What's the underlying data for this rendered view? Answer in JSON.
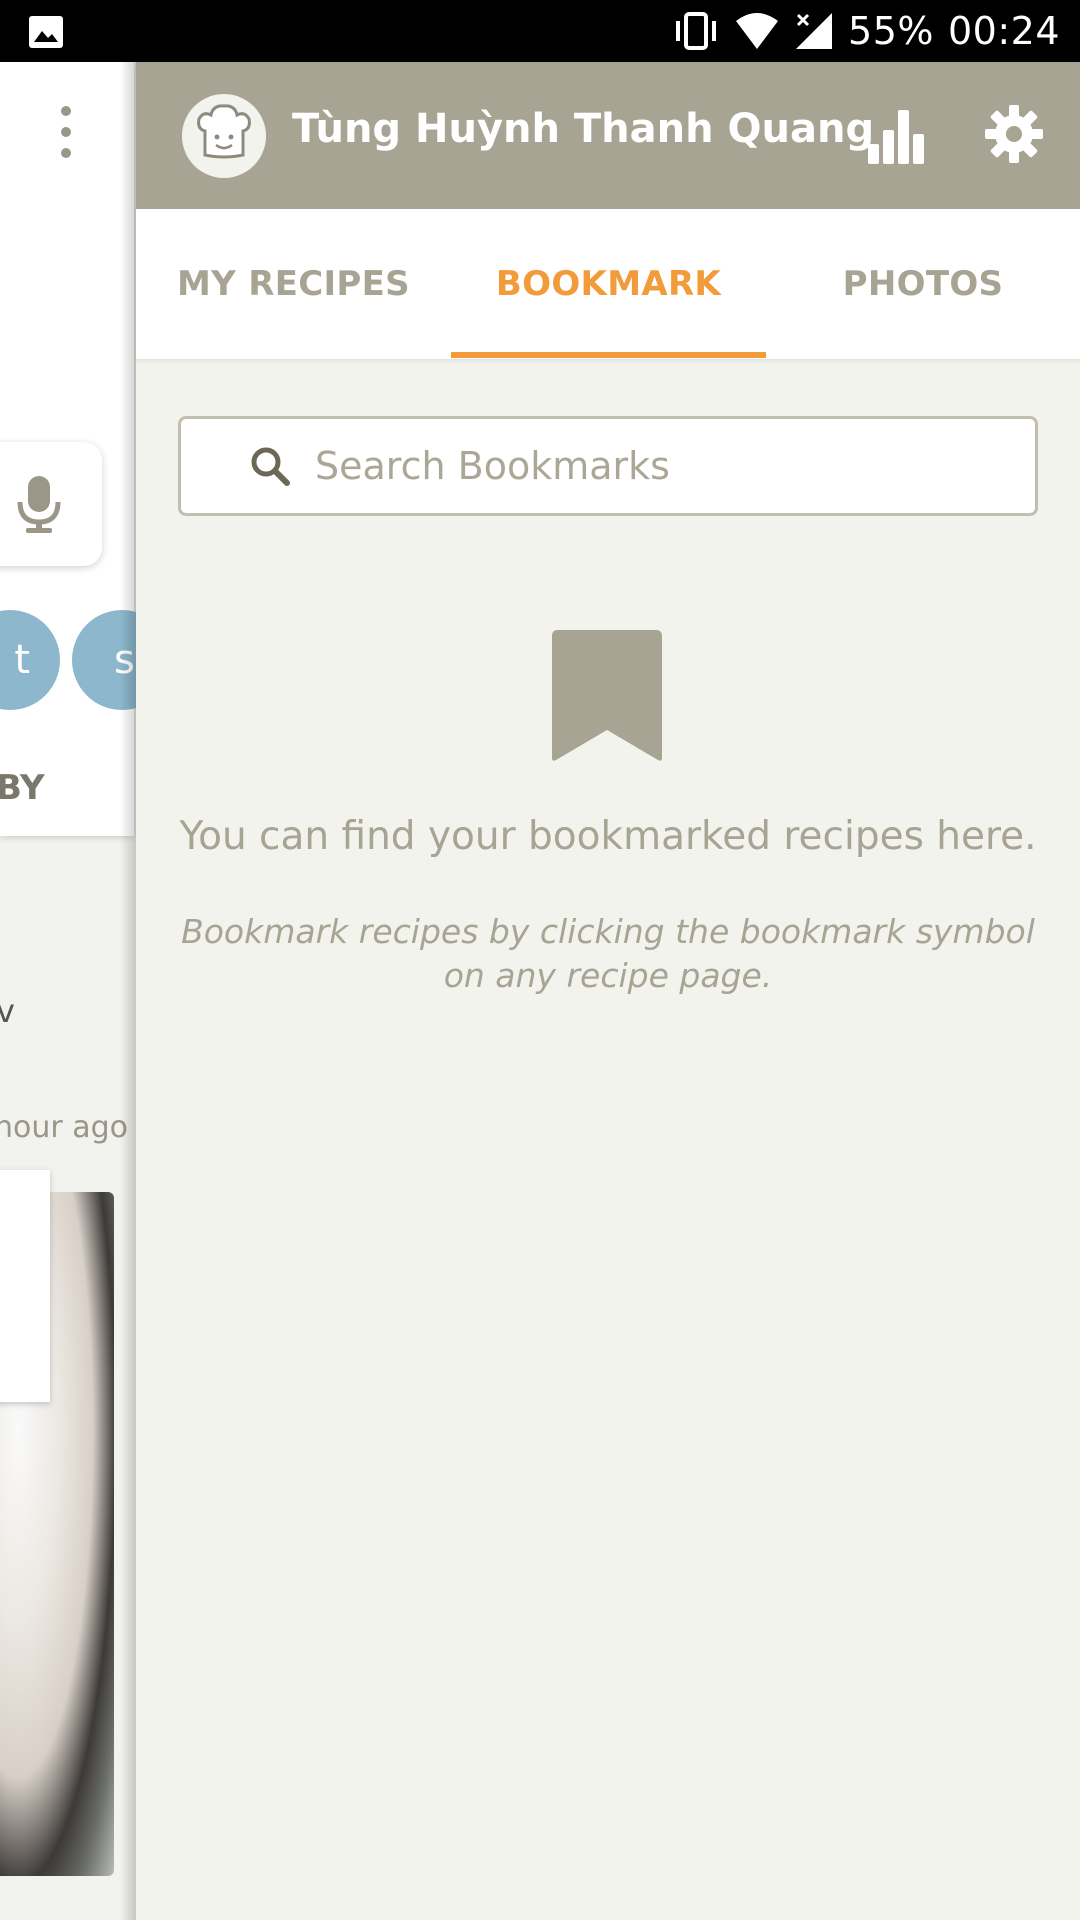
{
  "status_bar": {
    "battery": "55%",
    "time": "00:24",
    "icons": [
      "gallery-icon",
      "vibrate-icon",
      "wifi-icon",
      "signal-icon"
    ]
  },
  "background_app": {
    "pill_1_letter": "t",
    "pill_2_letter": "s",
    "section_label": "BY",
    "partial_text": "v",
    "timestamp": "hour ago"
  },
  "drawer": {
    "username": "Tùng Huỳnh Thanh Quang",
    "tabs": [
      {
        "label": "MY RECIPES",
        "active": false
      },
      {
        "label": "BOOKMARK",
        "active": true
      },
      {
        "label": "PHOTOS",
        "active": false
      }
    ],
    "search": {
      "placeholder": "Search Bookmarks",
      "value": ""
    },
    "empty_state": {
      "title": "You can find your bookmarked recipes here.",
      "subtitle": "Bookmark recipes by clicking the bookmark symbol on any recipe page."
    }
  },
  "colors": {
    "header": "#a8a493",
    "accent": "#f29b3a",
    "drawer_bg": "#f3f3ee",
    "muted_text": "#a8a493"
  }
}
